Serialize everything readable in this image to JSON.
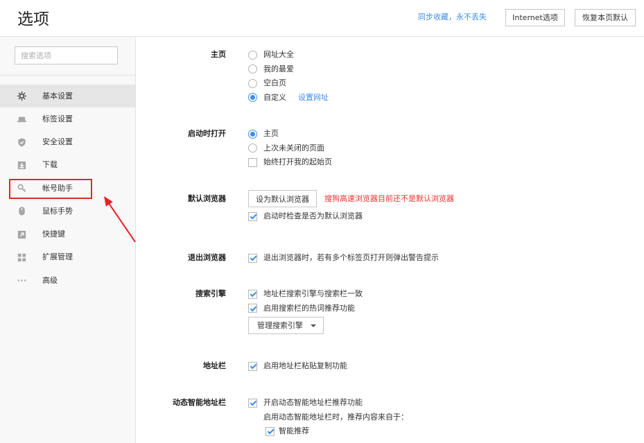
{
  "header": {
    "title": "选项",
    "sync_link": "同步收藏，永不丢失",
    "internet_options_label": "Internet选项",
    "restore_defaults_label": "恢复本页默认"
  },
  "sidebar": {
    "search_placeholder": "搜索选项",
    "items": [
      {
        "label": "基本设置",
        "icon": "gear-icon",
        "selected": true
      },
      {
        "label": "标签设置",
        "icon": "tab-icon",
        "selected": false
      },
      {
        "label": "安全设置",
        "icon": "shield-icon",
        "selected": false
      },
      {
        "label": "下载",
        "icon": "download-icon",
        "selected": false
      },
      {
        "label": "帐号助手",
        "icon": "key-icon",
        "selected": false
      },
      {
        "label": "鼠标手势",
        "icon": "mouse-icon",
        "selected": false
      },
      {
        "label": "快捷键",
        "icon": "shortcut-icon",
        "selected": false
      },
      {
        "label": "扩展管理",
        "icon": "grid-icon",
        "selected": false
      },
      {
        "label": "高级",
        "icon": "more-icon",
        "selected": false
      }
    ]
  },
  "settings": {
    "homepage": {
      "label": "主页",
      "options": [
        {
          "label": "网址大全",
          "checked": false
        },
        {
          "label": "我的最爱",
          "checked": false
        },
        {
          "label": "空白页",
          "checked": false
        },
        {
          "label": "自定义",
          "checked": true
        }
      ],
      "set_url_link": "设置网址"
    },
    "startup": {
      "label": "启动时打开",
      "options": [
        {
          "label": "主页",
          "checked": true
        },
        {
          "label": "上次未关闭的页面",
          "checked": false
        }
      ],
      "always_open_start_page": {
        "label": "始终打开我的起始页",
        "checked": false
      }
    },
    "default_browser": {
      "label": "默认浏览器",
      "set_default_button": "设为默认浏览器",
      "warning": "搜狗高速浏览器目前还不是默认浏览器",
      "check_on_startup": {
        "label": "启动时检查是否为默认浏览器",
        "checked": true
      }
    },
    "exit_browser": {
      "label": "退出浏览器",
      "warn_multiple_tabs": {
        "label": "退出浏览器时，若有多个标签页打开则弹出警告提示",
        "checked": true
      }
    },
    "search_engine": {
      "label": "搜索引擎",
      "sync_with_search_bar": {
        "label": "地址栏搜索引擎与搜索栏一致",
        "checked": true
      },
      "hot_words": {
        "label": "启用搜索栏的热词推荐功能",
        "checked": true
      },
      "manage_button": "管理搜索引擎"
    },
    "address_bar": {
      "label": "地址栏",
      "paste_copy": {
        "label": "启用地址栏粘贴复制功能",
        "checked": true
      }
    },
    "smart_address_bar": {
      "label": "动态智能地址栏",
      "enable": {
        "label": "开启动态智能地址栏推荐功能",
        "checked": true
      },
      "source_note": "启用动态智能地址栏时，推荐内容来自于：",
      "smart_recommend": {
        "label": "智能推荐",
        "checked": true
      }
    }
  },
  "theme": {
    "accent": "#3c8ee6",
    "warning": "#f0312d",
    "annotation": "#e3262b",
    "selected_bg": "#e6e6e6"
  }
}
